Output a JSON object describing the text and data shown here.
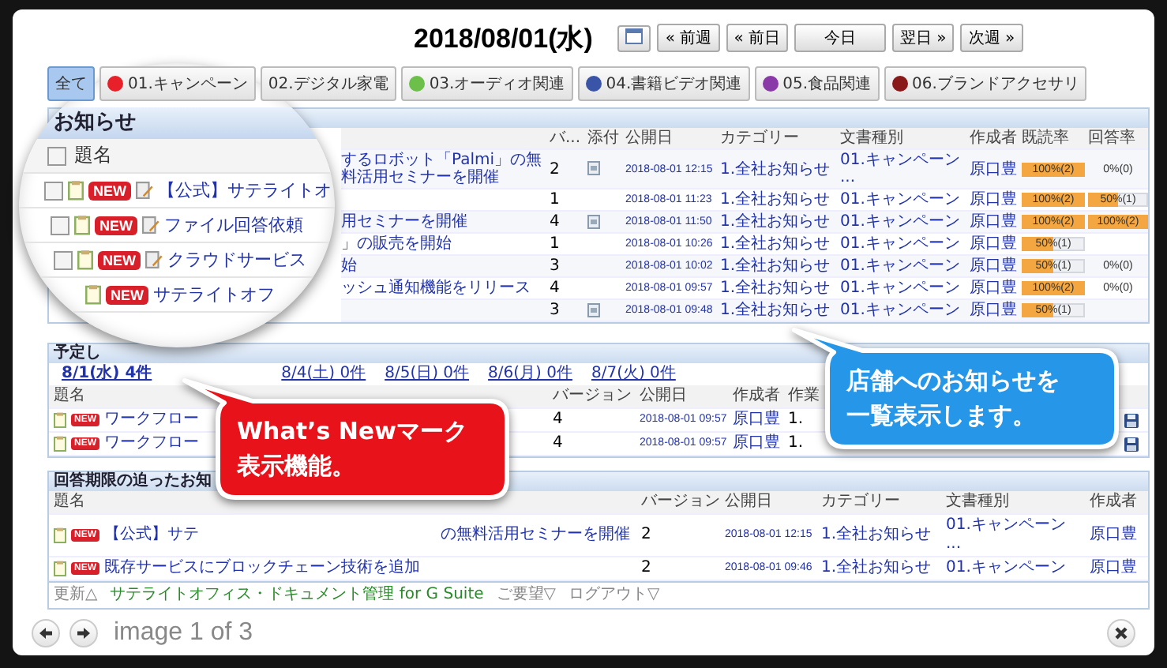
{
  "date_nav": {
    "date": "2018/08/01(水)",
    "buttons": [
      "« 前週",
      "« 前日",
      "今日",
      "翌日 »",
      "次週 »"
    ]
  },
  "categories": [
    {
      "label": "全て",
      "selected": true
    },
    {
      "label": "01.キャンペーン",
      "color": "#e8202a",
      "selected": false
    },
    {
      "label": "02.デジタル家電",
      "selected": false
    },
    {
      "label": "03.オーディオ関連",
      "color": "#6cc04a",
      "selected": false
    },
    {
      "label": "04.書籍ビデオ関連",
      "color": "#3a55a8",
      "selected": false
    },
    {
      "label": "05.食品関連",
      "color": "#8a3aa8",
      "selected": false
    },
    {
      "label": "06.ブランドアクセサリ",
      "color": "#8a1a1a",
      "selected": false
    }
  ],
  "magnifier": {
    "title": "お知らせ",
    "column": "題名",
    "header_checked": false,
    "rows": [
      {
        "checked": false,
        "badge": "NEW",
        "edit_icon": true,
        "title": "【公式】サテライトオ"
      },
      {
        "checked": false,
        "badge": "NEW",
        "edit_icon": true,
        "title": "ファイル回答依頼"
      },
      {
        "checked": false,
        "badge": "NEW",
        "edit_icon": true,
        "title": "クラウドサービス"
      },
      {
        "badge": "NEW",
        "edit_icon": false,
        "title": "サテライトオフ"
      }
    ]
  },
  "notices": {
    "columns": [
      "バ...",
      "添付",
      "公開日",
      "カテゴリー",
      "文書種別",
      "作成者",
      "既読率",
      "回答率"
    ],
    "rows": [
      {
        "title": "するロボット「Palmi」の無料活用セミナーを開催",
        "version": "2",
        "attached": true,
        "date": "2018-08-01 12:15",
        "category": "1.全社お知らせ",
        "doc_type": "01.キャンペーン ...",
        "author": "原口豊",
        "read": {
          "text": "100%(2)",
          "level": 1
        },
        "answer": {
          "text": "0%(0)"
        }
      },
      {
        "title": "",
        "version": "1",
        "attached": false,
        "date": "2018-08-01 11:23",
        "category": "1.全社お知らせ",
        "doc_type": "01.キャンペーン",
        "author": "原口豊",
        "read": {
          "text": "100%(2)",
          "level": 1
        },
        "answer": {
          "text": "50%(1)",
          "level": 0.5
        }
      },
      {
        "title": "用セミナーを開催",
        "version": "4",
        "attached": true,
        "date": "2018-08-01 11:50",
        "category": "1.全社お知らせ",
        "doc_type": "01.キャンペーン",
        "author": "原口豊",
        "read": {
          "text": "100%(2)",
          "level": 1
        },
        "answer": {
          "text": "100%(2)",
          "level": 1
        }
      },
      {
        "title": "」の販売を開始",
        "version": "1",
        "attached": false,
        "date": "2018-08-01 10:26",
        "category": "1.全社お知らせ",
        "doc_type": "01.キャンペーン",
        "author": "原口豊",
        "read": {
          "text": "50%(1)",
          "level": 0.5
        }
      },
      {
        "title": "始",
        "version": "3",
        "attached": false,
        "date": "2018-08-01 10:02",
        "category": "1.全社お知らせ",
        "doc_type": "01.キャンペーン",
        "author": "原口豊",
        "read": {
          "text": "50%(1)",
          "level": 0.5
        },
        "answer": {
          "text": "0%(0)"
        }
      },
      {
        "title": "ッシュ通知機能をリリース",
        "version": "4",
        "attached": false,
        "date": "2018-08-01 09:57",
        "category": "1.全社お知らせ",
        "doc_type": "01.キャンペーン",
        "author": "原口豊",
        "read": {
          "text": "100%(2)",
          "level": 1
        },
        "answer": {
          "text": "0%(0)"
        }
      },
      {
        "title": "",
        "version": "3",
        "attached": true,
        "date": "2018-08-01 09:48",
        "category": "1.全社お知らせ",
        "doc_type": "01.キャンペーン",
        "author": "原口豊",
        "read": {
          "text": "50%(1)",
          "level": 0.5
        }
      }
    ]
  },
  "schedule": {
    "title": "予定し",
    "days": [
      {
        "label": "8/1(水) 4件",
        "selected": true
      },
      {
        "label": "8/4(土) 0件",
        "selected": false
      },
      {
        "label": "8/5(日) 0件",
        "selected": false
      },
      {
        "label": "8/6(月) 0件",
        "selected": false
      },
      {
        "label": "8/7(火) 0件",
        "selected": false
      }
    ],
    "columns": [
      "題名",
      "バージョン",
      "公開日",
      "作成者",
      "作業"
    ],
    "rows": [
      {
        "badge": "NEW",
        "title": "ワークフロー",
        "version": "4",
        "date": "2018-08-01 09:57",
        "author": "原口豊",
        "work": "1."
      },
      {
        "badge": "NEW",
        "title": "ワークフロー",
        "version": "4",
        "date": "2018-08-01 09:57",
        "author": "原口豊",
        "work": "1."
      }
    ]
  },
  "deadline": {
    "title": "回答期限の迫ったお知",
    "columns": [
      "題名",
      "バージョン",
      "公開日",
      "カテゴリー",
      "文書種別",
      "作成者"
    ],
    "rows": [
      {
        "badge": "NEW",
        "title": "【公式】サテ",
        "title_tail": "の無料活用セミナーを開催",
        "version": "2",
        "date": "2018-08-01 12:15",
        "category": "1.全社お知らせ",
        "doc_type": "01.キャンペーン ...",
        "author": "原口豊"
      },
      {
        "badge": "NEW",
        "title": "既存サービスにブロックチェーン技術を追加",
        "version": "2",
        "date": "2018-08-01 09:46",
        "category": "1.全社お知らせ",
        "doc_type": "01.キャンペーン",
        "author": "原口豊"
      }
    ]
  },
  "footer": [
    {
      "kind": "muted",
      "text": "更新△"
    },
    {
      "kind": "link",
      "text": "サテライトオフィス・ドキュメント管理 for G Suite"
    },
    {
      "kind": "muted",
      "text": "ご要望▽"
    },
    {
      "kind": "muted",
      "text": "ログアウト▽"
    }
  ],
  "callouts": [
    {
      "kind": "red",
      "lines": [
        "What’s Newマーク",
        "表示機能。"
      ]
    },
    {
      "kind": "blue",
      "lines": [
        "店舗へのお知らせを",
        "一覧表示します。"
      ]
    }
  ],
  "lightbox": {
    "caption": "image 1 of 3"
  }
}
